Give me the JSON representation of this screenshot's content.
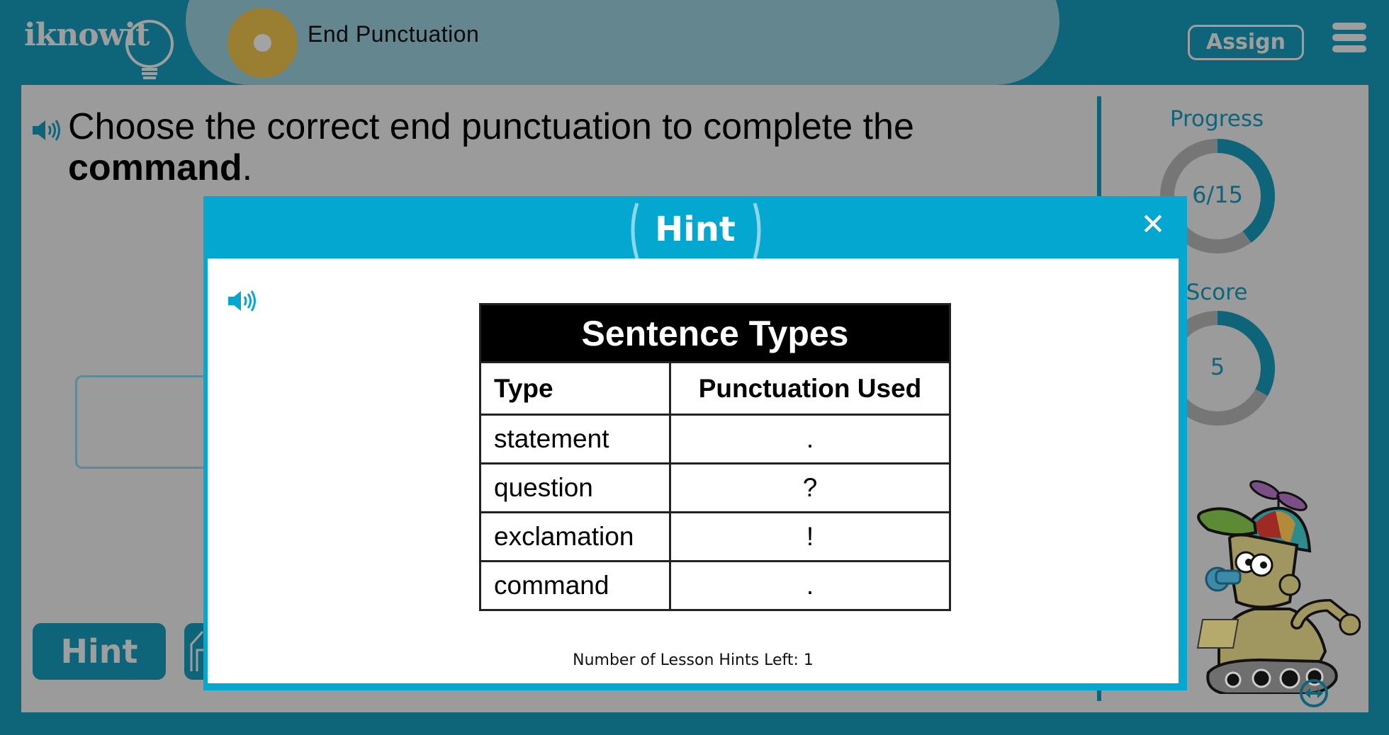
{
  "header": {
    "logo_text": "iknowit",
    "lesson_title": "End Punctuation",
    "assign_label": "Assign",
    "menu_icon": "hamburger-menu-icon"
  },
  "question": {
    "text_before": "Choose the correct end punctuation to complete the ",
    "emphasis": "command",
    "text_after": ".",
    "audio_icon": "speaker-icon"
  },
  "controls": {
    "hint_label": "Hint"
  },
  "sidebar": {
    "progress_label": "Progress",
    "progress_value": "6/15",
    "progress_fraction": 0.4,
    "score_label": "Score",
    "score_value": "5",
    "score_fraction": 0.33
  },
  "modal": {
    "title": "Hint",
    "close_icon": "close-icon",
    "audio_icon": "speaker-icon",
    "table": {
      "title": "Sentence Types",
      "headers": [
        "Type",
        "Punctuation Used"
      ],
      "rows": [
        [
          "statement",
          "."
        ],
        [
          "question",
          "?"
        ],
        [
          "exclamation",
          "!"
        ],
        [
          "command",
          "."
        ]
      ]
    },
    "hints_left_text": "Number of Lesson Hints Left: 1"
  },
  "colors": {
    "frame": "#0e6479",
    "overlay_gray": "#9b9b9b",
    "modal_accent": "#03a7cf",
    "lesson_icon": "#9a7f33",
    "ring_track": "#767676"
  }
}
